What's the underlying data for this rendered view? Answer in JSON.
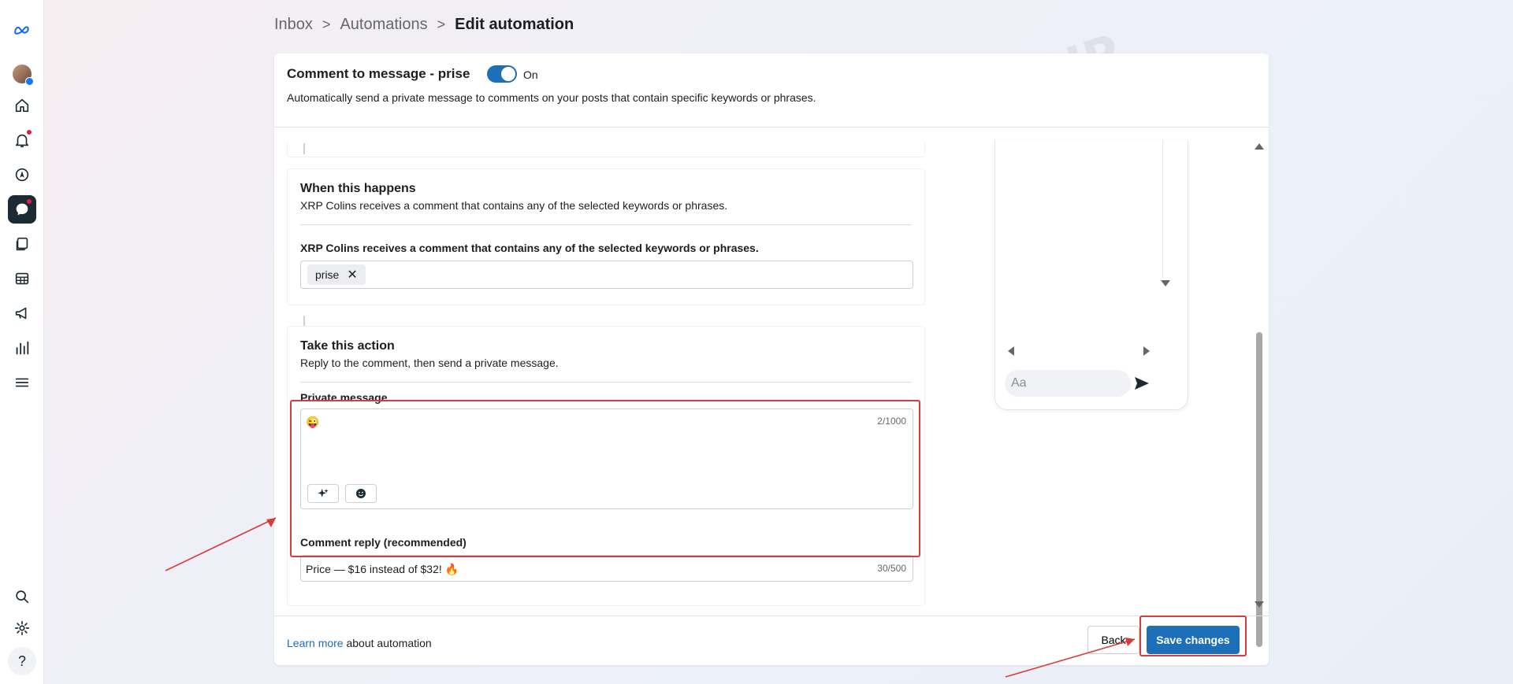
{
  "colors": {
    "accent": "#1d6fb8",
    "highlight": "#d93b3b",
    "rail_active": "#1c2b33",
    "notification": "#e41e3f"
  },
  "rail": {
    "icons": [
      "meta-logo-icon",
      "profile-avatar",
      "home-icon",
      "bell-icon",
      "compass-icon",
      "chat-icon",
      "pages-icon",
      "table-icon",
      "megaphone-icon",
      "chart-icon",
      "menu-icon",
      "search-icon",
      "settings-icon",
      "help-icon"
    ],
    "help_label": "?"
  },
  "breadcrumb": {
    "inbox": "Inbox",
    "automations": "Automations",
    "current": "Edit automation",
    "separator": ">"
  },
  "automation": {
    "title": "Comment to message - prise",
    "toggle_label": "On",
    "toggle_state": "on",
    "description": "Automatically send a private message to comments on your posts that contain specific keywords or phrases."
  },
  "trigger": {
    "title": "When this happens",
    "subtitle": "XRP Colins receives a comment that contains any of the selected keywords or phrases.",
    "field_label": "XRP Colins receives a comment that contains any of the selected keywords or phrases.",
    "keywords": [
      "prise"
    ],
    "remove_symbol": "✕"
  },
  "action": {
    "title": "Take this action",
    "subtitle": "Reply to the comment, then send a private message.",
    "private_message_label": "Private message",
    "private_message_value": "😜",
    "private_message_counter": "2/1000",
    "comment_reply_label": "Comment reply (recommended)",
    "comment_reply_value": "Price — $16 instead of $32! 🔥",
    "comment_reply_counter": "30/500"
  },
  "preview": {
    "input_placeholder": "Aa"
  },
  "footer": {
    "learn_link": "Learn more",
    "learn_text": " about automation",
    "back_label": "Back",
    "save_label": "Save changes"
  },
  "watermark": "CPA.RIP"
}
